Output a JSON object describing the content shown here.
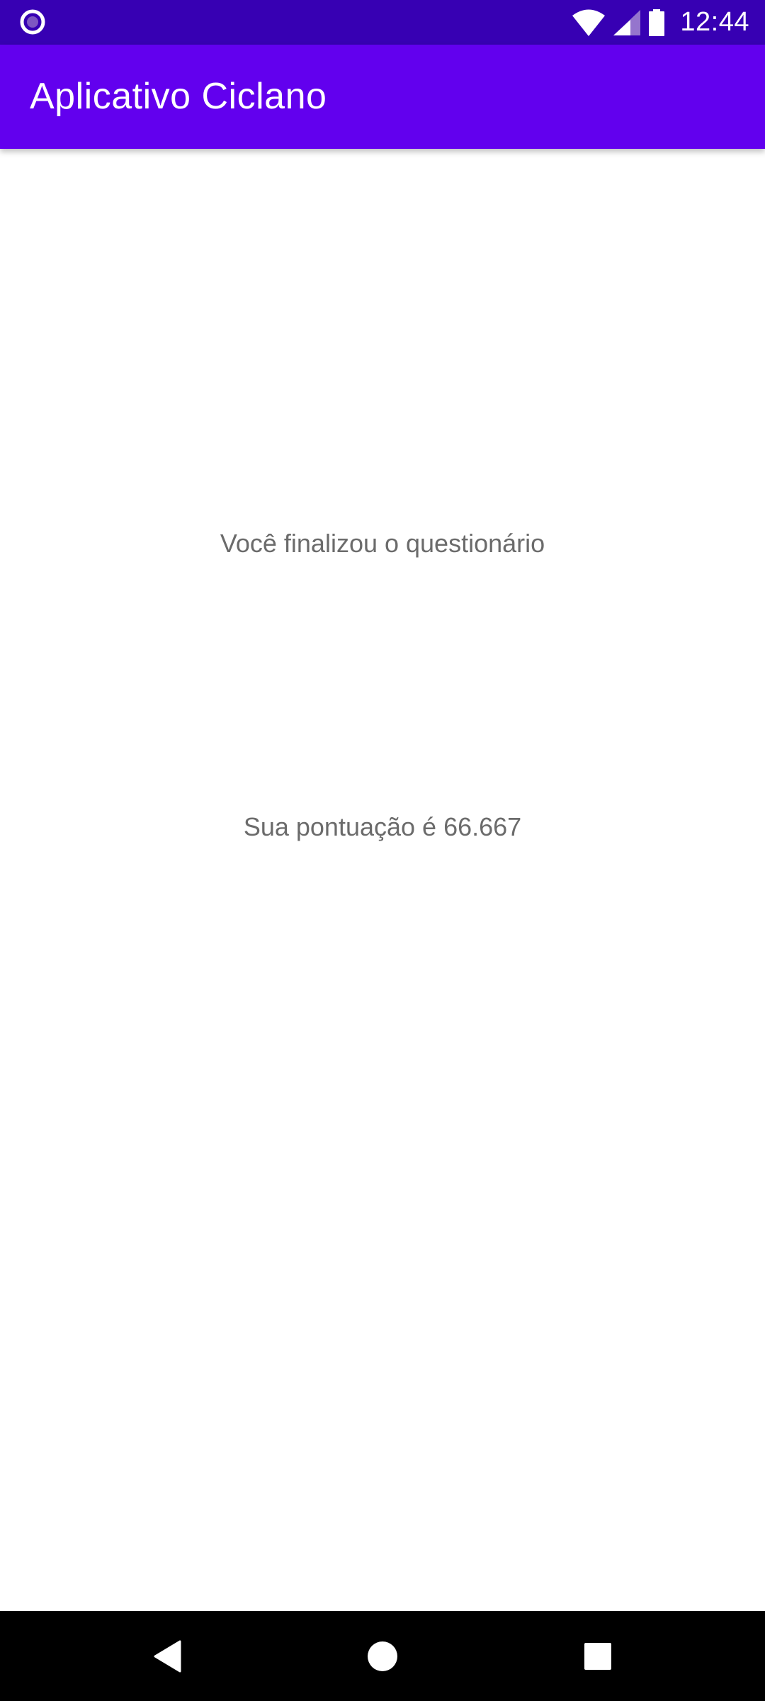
{
  "status_bar": {
    "time": "12:44",
    "icons": [
      "app-notification-icon",
      "wifi-icon",
      "cellular-signal-icon",
      "battery-icon"
    ]
  },
  "app_bar": {
    "title": "Aplicativo Ciclano"
  },
  "main": {
    "finished_message": "Você finalizou o questionário",
    "score_message": "Sua pontuação é 66.667"
  },
  "nav_bar": {
    "buttons": [
      "back",
      "home",
      "recents"
    ]
  },
  "colors": {
    "status_bar": "#3700b3",
    "app_bar": "#6200ee",
    "text": "#6b6b6b",
    "background": "#ffffff",
    "nav_bar": "#000000"
  }
}
